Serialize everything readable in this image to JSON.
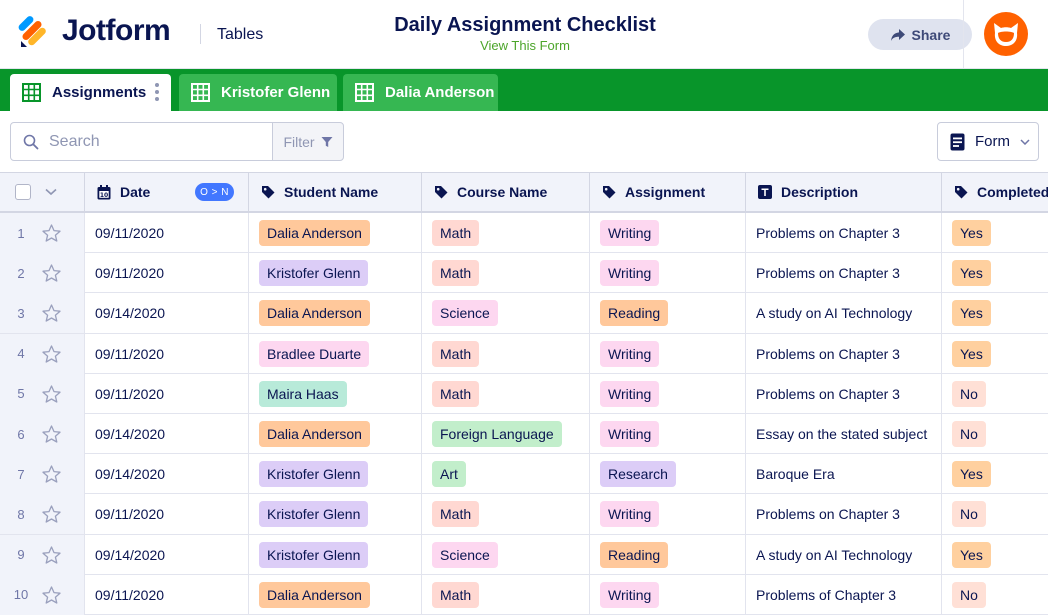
{
  "header": {
    "logo_text": "Jotform",
    "product_label": "Tables",
    "form_title": "Daily Assignment Checklist",
    "view_form_link": "View This Form",
    "share_label": "Share",
    "brand_colors": {
      "navy": "#0a1551",
      "orange": "#ff6100",
      "green": "#08952a",
      "light_green": "#36b752"
    }
  },
  "tabs": [
    {
      "label": "Assignments",
      "active": true,
      "icon": "grid-icon"
    },
    {
      "label": "Kristofer Glenn",
      "active": false,
      "icon": "grid-icon"
    },
    {
      "label": "Dalia Anderson",
      "active": false,
      "icon": "grid-icon"
    }
  ],
  "toolbar": {
    "search_placeholder": "Search",
    "filter_label": "Filter",
    "form_label": "Form"
  },
  "table": {
    "columns": [
      {
        "label": "Date",
        "icon": "calendar-icon",
        "sort_badge": "O > N"
      },
      {
        "label": "Student Name",
        "icon": "tag-icon"
      },
      {
        "label": "Course Name",
        "icon": "tag-icon"
      },
      {
        "label": "Assignment",
        "icon": "tag-icon"
      },
      {
        "label": "Description",
        "icon": "text-icon"
      },
      {
        "label": "Completed",
        "icon": "tag-icon"
      }
    ],
    "rows": [
      {
        "num": "1",
        "date": "09/11/2020",
        "student": "Dalia Anderson",
        "course": "Math",
        "assignment": "Writing",
        "description": "Problems on Chapter 3",
        "completed": "Yes"
      },
      {
        "num": "2",
        "date": "09/11/2020",
        "student": "Kristofer Glenn",
        "course": "Math",
        "assignment": "Writing",
        "description": "Problems on Chapter 3",
        "completed": "Yes"
      },
      {
        "num": "3",
        "date": "09/14/2020",
        "student": "Dalia Anderson",
        "course": "Science",
        "assignment": "Reading",
        "description": "A study on AI Technology",
        "completed": "Yes"
      },
      {
        "num": "4",
        "date": "09/11/2020",
        "student": "Bradlee Duarte",
        "course": "Math",
        "assignment": "Writing",
        "description": "Problems on Chapter 3",
        "completed": "Yes"
      },
      {
        "num": "5",
        "date": "09/11/2020",
        "student": "Maira Haas",
        "course": "Math",
        "assignment": "Writing",
        "description": "Problems on Chapter 3",
        "completed": "No"
      },
      {
        "num": "6",
        "date": "09/14/2020",
        "student": "Dalia Anderson",
        "course": "Foreign Language",
        "assignment": "Writing",
        "description": "Essay on the stated subject",
        "completed": "No"
      },
      {
        "num": "7",
        "date": "09/14/2020",
        "student": "Kristofer Glenn",
        "course": "Art",
        "assignment": "Research",
        "description": "Baroque Era",
        "completed": "Yes"
      },
      {
        "num": "8",
        "date": "09/11/2020",
        "student": "Kristofer Glenn",
        "course": "Math",
        "assignment": "Writing",
        "description": "Problems on Chapter 3",
        "completed": "No"
      },
      {
        "num": "9",
        "date": "09/14/2020",
        "student": "Kristofer Glenn",
        "course": "Science",
        "assignment": "Reading",
        "description": "A study on AI Technology",
        "completed": "Yes"
      },
      {
        "num": "10",
        "date": "09/11/2020",
        "student": "Dalia Anderson",
        "course": "Math",
        "assignment": "Writing",
        "description": "Problems of Chapter 3",
        "completed": "No"
      }
    ]
  },
  "tag_colors": {
    "Dalia Anderson": "#ffc89b",
    "Kristofer Glenn": "#dccdf7",
    "Bradlee Duarte": "#fdd7f0",
    "Maira Haas": "#b8ead9",
    "Math": "#ffd8d2",
    "Science": "#fdd7f0",
    "Foreign Language": "#c2eecb",
    "Art": "#c2eecb",
    "Writing": "#fdd7f0",
    "Reading": "#ffc89b",
    "Research": "#dccdf7",
    "Yes": "#ffd09f",
    "No": "#ffe0d6"
  }
}
